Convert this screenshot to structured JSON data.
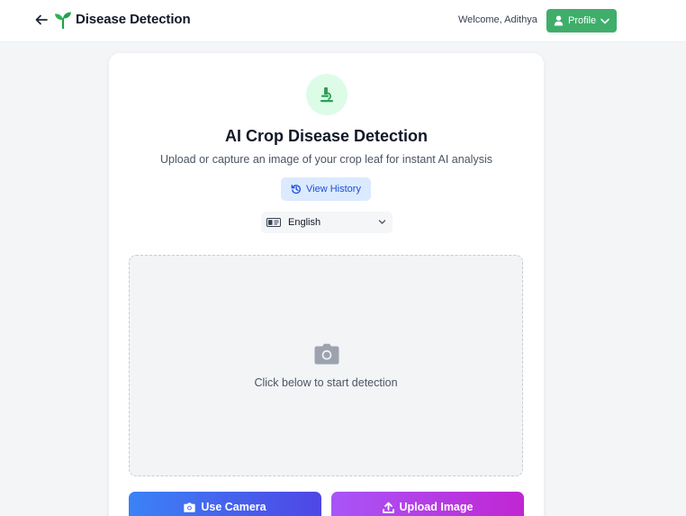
{
  "header": {
    "title": "Disease Detection",
    "welcome": "Welcome, Adithya",
    "profile_label": "Profile",
    "icons": {
      "back": "arrow-left-icon",
      "brand": "sprout-icon",
      "profile": "user-icon",
      "dropdown": "chevron-down-icon"
    }
  },
  "main": {
    "title": "AI Crop Disease Detection",
    "subtitle": "Upload or capture an image of your crop leaf for instant AI analysis",
    "history_label": "View History",
    "language": {
      "selected": "English"
    },
    "dropzone_text": "Click below to start detection",
    "camera_label": "Use Camera",
    "upload_label": "Upload Image",
    "icons": {
      "hero": "microscope-icon",
      "history": "history-icon",
      "language": "language-icon",
      "dropzone": "camera-icon"
    }
  },
  "colors": {
    "brand_green": "#3fae6a",
    "history_bg": "#dbeafe",
    "history_text": "#1d4ed8",
    "camera_gradient": [
      "#3b82f6",
      "#4f46e5"
    ],
    "upload_gradient": [
      "#a855f7",
      "#c026d3"
    ]
  }
}
